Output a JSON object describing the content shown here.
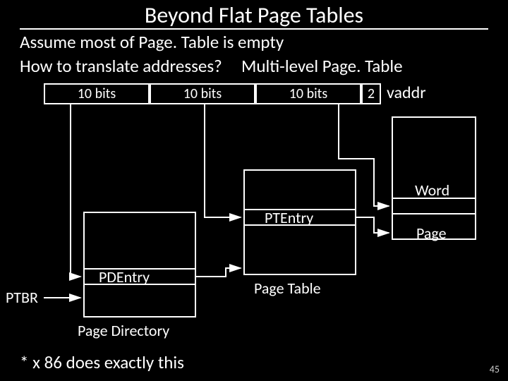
{
  "title": "Beyond Flat Page Tables",
  "line1": "Assume most of Page. Table is empty",
  "line2a": "How to translate addresses?",
  "line2b": "Multi-level Page. Table",
  "vaddr_fields": {
    "a": "10 bits",
    "b": "10 bits",
    "c": "10 bits",
    "d": "2"
  },
  "vaddr_label": "vaddr",
  "labels": {
    "pdentry": "PDEntry",
    "ptentry": "PTEntry",
    "page_directory": "Page Directory",
    "page_table": "Page Table",
    "page": "Page",
    "word": "Word",
    "ptbr": "PTBR"
  },
  "footnote": "* x 86 does exactly this",
  "slide_no": "45"
}
